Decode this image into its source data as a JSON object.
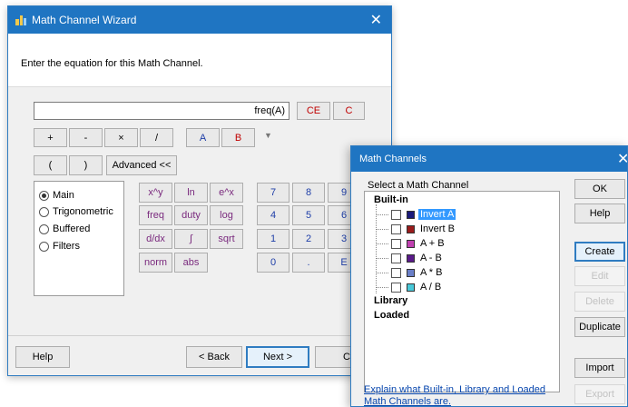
{
  "wizard": {
    "title": "Math Channel Wizard",
    "close_glyph": "✕",
    "prompt": "Enter the equation for this Math Channel.",
    "equation_value": "freq(A)",
    "ce_label": "CE",
    "c_label": "C",
    "operators": [
      "+",
      "-",
      "×",
      "/"
    ],
    "channels": [
      "A",
      "B"
    ],
    "paren_open": "(",
    "paren_close": ")",
    "advanced_label": "Advanced <<",
    "radio_options": [
      {
        "label": "Main",
        "selected": true
      },
      {
        "label": "Trigonometric",
        "selected": false
      },
      {
        "label": "Buffered",
        "selected": false
      },
      {
        "label": "Filters",
        "selected": false
      }
    ],
    "functions": [
      "x^y",
      "ln",
      "e^x",
      "freq",
      "duty",
      "log",
      "d/dx",
      "∫",
      "sqrt",
      "norm",
      "abs"
    ],
    "digits": [
      "7",
      "8",
      "9",
      "4",
      "5",
      "6",
      "1",
      "2",
      "3",
      "0",
      ".",
      "E"
    ],
    "help_label": "Help",
    "back_label": "< Back",
    "next_label": "Next >",
    "cancel_label": "Ca"
  },
  "math_channels": {
    "title": "Math Channels",
    "close_glyph": "✕",
    "select_label": "Select a Math Channel",
    "groups": {
      "builtin": "Built-in",
      "library": "Library",
      "loaded": "Loaded"
    },
    "items": [
      {
        "label": "Invert A",
        "color": "#1a1a7a",
        "selected": true
      },
      {
        "label": "Invert B",
        "color": "#9a1b1b",
        "selected": false
      },
      {
        "label": "A + B",
        "color": "#c040b0",
        "selected": false
      },
      {
        "label": "A - B",
        "color": "#5a1a8a",
        "selected": false
      },
      {
        "label": "A * B",
        "color": "#6a7fc8",
        "selected": false
      },
      {
        "label": "A / B",
        "color": "#48c8d8",
        "selected": false
      }
    ],
    "buttons": {
      "ok": "OK",
      "help": "Help",
      "create": "Create",
      "edit": "Edit",
      "delete": "Delete",
      "duplicate": "Duplicate",
      "import": "Import",
      "export": "Export"
    },
    "link_text": "Explain what Built-in, Library and Loaded Math Channels are."
  },
  "colors": {
    "titlebar": "#1f75c2",
    "channel_a": "#1e3ea8",
    "channel_b": "#c00000",
    "function_text": "#7a2a7e"
  }
}
